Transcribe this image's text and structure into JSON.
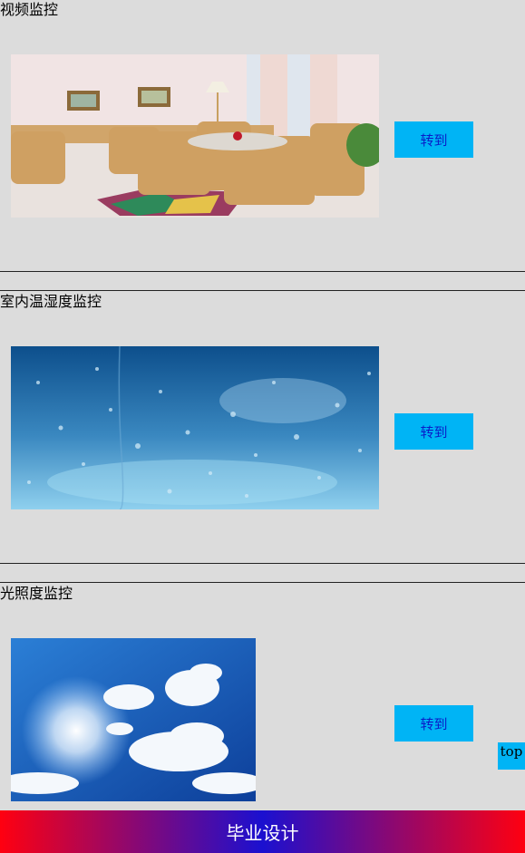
{
  "sections": [
    {
      "title": "视频监控",
      "button_label": "转到"
    },
    {
      "title": "室内温湿度监控",
      "button_label": "转到"
    },
    {
      "title": "光照度监控",
      "button_label": "转到"
    }
  ],
  "top_label": "top",
  "footer_text": "毕业设计"
}
